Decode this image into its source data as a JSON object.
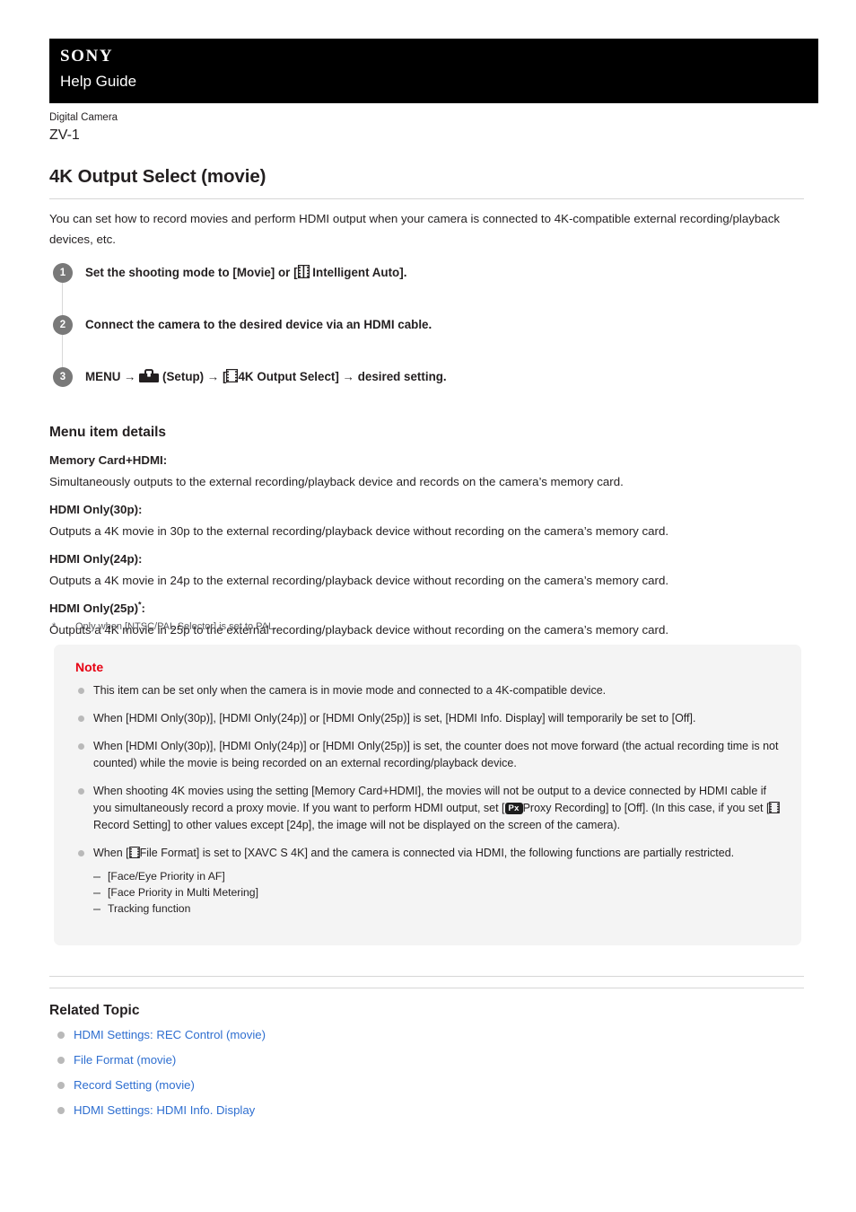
{
  "header": {
    "brand": "SONY",
    "guide_title": "Help Guide",
    "bar_color": "#000000"
  },
  "product": {
    "category": "Digital Camera",
    "model": "ZV-1"
  },
  "page_title": "4K Output Select (movie)",
  "intro": "You can set how to record movies and perform HDMI output when your camera is connected to 4K-compatible external recording/playback devices, etc.",
  "steps": [
    {
      "number": "1",
      "text_before": "Set the shooting mode to [Movie] or [",
      "icon": "movie-film-icon",
      "text_after": "Intelligent Auto]."
    },
    {
      "number": "2",
      "text_before": "Connect the camera to the desired device via an HDMI cable.",
      "icon": "",
      "text_after": ""
    },
    {
      "number": "3",
      "text_menu": "MENU",
      "arrow": "→",
      "icon_setup": "toolbox-setup-icon",
      "text_setup": "(Setup)",
      "icon_movie": "movie-film-icon",
      "text_item": "4K Output Select]",
      "text_bracket_open": "[",
      "text_end": "desired setting."
    }
  ],
  "menu_details": {
    "heading": "Menu item details",
    "entries": [
      {
        "term": "Memory Card+HDMI:",
        "has_asterisk": false,
        "definition": "Simultaneously outputs to the external recording/playback device and records on the camera’s memory card."
      },
      {
        "term": "HDMI Only(30p):",
        "has_asterisk": false,
        "definition": "Outputs a 4K movie in 30p to the external recording/playback device without recording on the camera’s memory card."
      },
      {
        "term": "HDMI Only(24p):",
        "has_asterisk": false,
        "definition": "Outputs a 4K movie in 24p to the external recording/playback device without recording on the camera’s memory card."
      },
      {
        "term": "HDMI Only(25p)",
        "has_asterisk": true,
        "term_suffix": ":",
        "definition": "Outputs a 4K movie in 25p to the external recording/playback device without recording on the camera’s memory card."
      }
    ],
    "footnote_mark": "*",
    "footnote_text": "Only when [NTSC/PAL Selector] is set to PAL."
  },
  "note": {
    "title": "Note",
    "title_color": "#e60012",
    "background": "#f4f4f4",
    "items": [
      {
        "text": "This item can be set only when the camera is in movie mode and connected to a 4K-compatible device."
      },
      {
        "text": "When [HDMI Only(30p)], [HDMI Only(24p)] or [HDMI Only(25p)] is set, [HDMI Info. Display] will temporarily be set to [Off]."
      },
      {
        "text": "When [HDMI Only(30p)], [HDMI Only(24p)] or [HDMI Only(25p)] is set, the counter does not move forward (the actual recording time is not counted) while the movie is being recorded on an external recording/playback device."
      },
      {
        "part1": "When shooting 4K movies using the setting [Memory Card+HDMI], the movies will not be output to a device connected by HDMI cable if you simultaneously record a proxy movie. If you want to perform HDMI output, set [",
        "badge": "Px",
        "part2": "Proxy Recording] to [Off]. (In this case, if you set [",
        "icon": "movie-film-icon",
        "part3": "Record Setting] to other values except [24p], the image will not be displayed on the screen of the camera)."
      },
      {
        "part1": "When [",
        "icon": "movie-film-icon",
        "part2": "File Format] is set to [XAVC S 4K] and the camera is connected via HDMI, the following functions are partially restricted.",
        "sub_items": [
          "[Face/Eye Priority in AF]",
          "[Face Priority in Multi Metering]",
          "Tracking function"
        ]
      }
    ]
  },
  "related": {
    "heading": "Related Topic",
    "link_color": "#2f6fd0",
    "links": [
      "HDMI Settings: REC Control (movie)",
      "File Format (movie)",
      "Record Setting (movie)",
      "HDMI Settings: HDMI Info. Display"
    ]
  }
}
